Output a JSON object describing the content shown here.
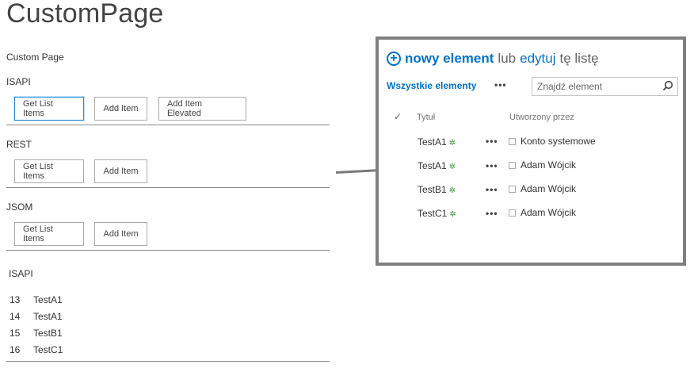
{
  "page": {
    "title": "CustomPage",
    "subtitle": "Custom Page"
  },
  "sections": [
    {
      "label": "ISAPI",
      "buttons": [
        "Get List Items",
        "Add Item",
        "Add Item Elevated"
      ]
    },
    {
      "label": "REST",
      "buttons": [
        "Get List Items",
        "Add Item"
      ]
    },
    {
      "label": "JSOM",
      "buttons": [
        "Get List Items",
        "Add Item"
      ]
    }
  ],
  "results": {
    "label": "ISAPI",
    "rows": [
      {
        "id": "13",
        "title": "TestA1"
      },
      {
        "id": "14",
        "title": "TestA1"
      },
      {
        "id": "15",
        "title": "TestB1"
      },
      {
        "id": "16",
        "title": "TestC1"
      }
    ]
  },
  "list": {
    "new_item": "nowy element",
    "or": "lub",
    "edit": "edytuj",
    "this_list": "tę listę",
    "view_name": "Wszystkie elementy",
    "view_menu": "•••",
    "search_placeholder": "Znajdź element",
    "check_glyph": "✓",
    "columns": {
      "title": "Tytuł",
      "created_by": "Utworzony przez"
    },
    "items": [
      {
        "title": "TestA1",
        "created_by": "Konto systemowe"
      },
      {
        "title": "TestA1",
        "created_by": "Adam Wójcik"
      },
      {
        "title": "TestB1",
        "created_by": "Adam Wójcik"
      },
      {
        "title": "TestC1",
        "created_by": "Adam Wójcik"
      }
    ],
    "item_menu": "•••",
    "new_badge": "✲"
  },
  "colors": {
    "accent": "#0072c6",
    "new_badge": "#2d9a2d",
    "panel_border": "#7f7f7f"
  }
}
